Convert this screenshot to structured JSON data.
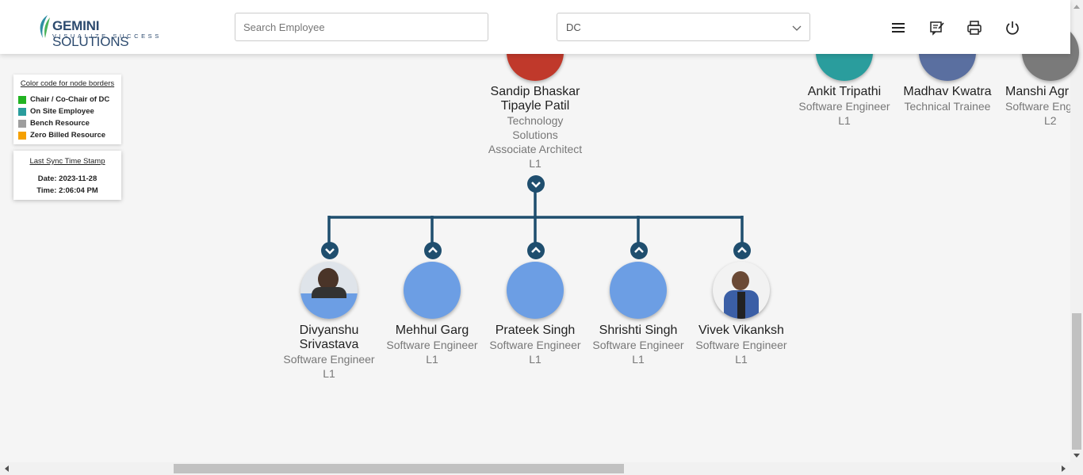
{
  "logo": {
    "name_bold": "GEMINI",
    "name_rest": " SOLUTIONS",
    "tagline": "VISUALIZE SUCCESS"
  },
  "search": {
    "placeholder": "Search Employee",
    "value": ""
  },
  "dc_select": {
    "value": "DC"
  },
  "header_icons": [
    "menu-icon",
    "feedback-icon",
    "print-icon",
    "power-icon"
  ],
  "legend": {
    "title": "Color code for node borders",
    "items": [
      {
        "label": "Chair / Co-Chair of DC",
        "color": "#22b322"
      },
      {
        "label": "On Site Employee",
        "color": "#2a9d9d"
      },
      {
        "label": "Bench Resource",
        "color": "#9e9e9e"
      },
      {
        "label": "Zero Billed Resource",
        "color": "#f5a000"
      }
    ]
  },
  "sync": {
    "title": "Last Sync Time Stamp",
    "date": "Date: 2023-11-28",
    "time": "Time: 2:06:04 PM"
  },
  "colors": {
    "connector": "#1f4e6e",
    "avatar_placeholder": "#6c9ee4"
  },
  "parent": {
    "name": "Sandip Bhaskar Tipayle Patil",
    "dept": "Technology Solutions",
    "title": "Associate Architect",
    "level": "L1"
  },
  "top_right": [
    {
      "name": "Ankit Tripathi",
      "title": "Software Engineer",
      "level": "L1"
    },
    {
      "name": "Madhav Kwatra",
      "title": "Technical Trainee",
      "level": ""
    },
    {
      "name": "Manshi Agr",
      "title": "Software Eng",
      "level": "L2"
    }
  ],
  "children": [
    {
      "name": "Divyanshu Srivastava",
      "title": "Software Engineer",
      "level": "L1"
    },
    {
      "name": "Mehhul Garg",
      "title": "Software Engineer",
      "level": "L1"
    },
    {
      "name": "Prateek Singh",
      "title": "Software Engineer",
      "level": "L1"
    },
    {
      "name": "Shrishti Singh",
      "title": "Software Engineer",
      "level": "L1"
    },
    {
      "name": "Vivek Vikanksh",
      "title": "Software Engineer",
      "level": "L1"
    }
  ]
}
